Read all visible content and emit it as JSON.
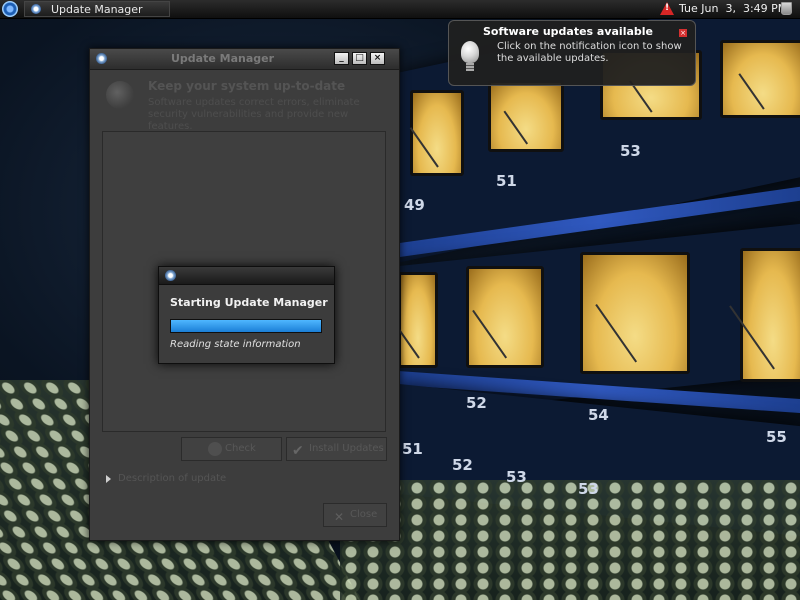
{
  "panel": {
    "task_label": "Update Manager",
    "clock": "Tue Jun  3,  3:49 PM"
  },
  "notification": {
    "title": "Software updates available",
    "body": "Click on the notification icon to show the available updates."
  },
  "window": {
    "title": "Update Manager",
    "header_title": "Keep your system up-to-date",
    "header_description": "Software updates correct errors, eliminate security vulnerabilities and provide new features.",
    "check_label": "Check",
    "install_label": "Install Updates",
    "description_expander": "Description of update",
    "close_label": "Close"
  },
  "dialog": {
    "title": "Starting Update Manager",
    "status": "Reading state information",
    "progress": 1.0
  },
  "wallpaper": {
    "numbers": [
      "53",
      "51",
      "49",
      "52",
      "54",
      "52",
      "53",
      "53",
      "55",
      "51"
    ]
  },
  "colors": {
    "progress": "#1b7fd6",
    "warning": "#d62626",
    "notification_close": "#d43030"
  },
  "icons": {
    "menu": "distro-logo-icon",
    "task": "update-manager-icon",
    "tray_warning": "warning-icon",
    "trash": "trash-icon",
    "notification": "lightbulb-icon"
  }
}
